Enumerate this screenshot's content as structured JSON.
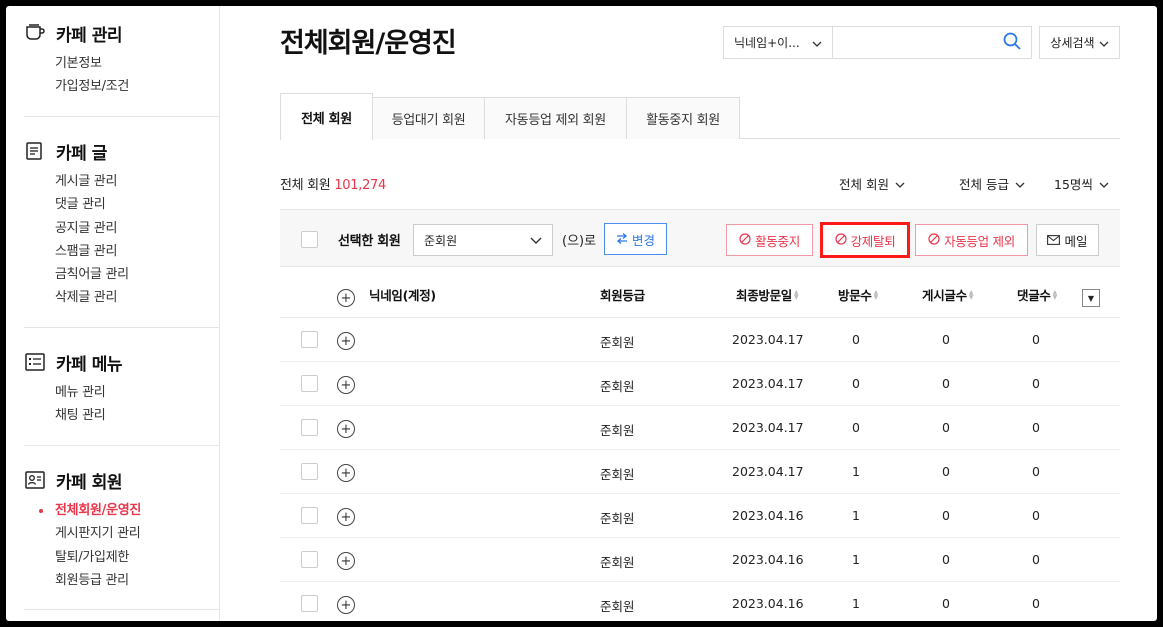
{
  "sidebar": {
    "sections": [
      {
        "title": "카페 관리",
        "icon": "cafe-cup-icon",
        "items": [
          "기본정보",
          "가입정보/조건"
        ]
      },
      {
        "title": "카페 글",
        "icon": "document-icon",
        "items": [
          "게시글 관리",
          "댓글 관리",
          "공지글 관리",
          "스팸글 관리",
          "금칙어글 관리",
          "삭제글 관리"
        ]
      },
      {
        "title": "카페 메뉴",
        "icon": "menu-list-icon",
        "items": [
          "메뉴 관리",
          "채팅 관리"
        ]
      },
      {
        "title": "카페 회원",
        "icon": "member-card-icon",
        "items": [
          "전체회원/운영진",
          "게시판지기 관리",
          "탈퇴/가입제한",
          "회원등급 관리"
        ]
      }
    ],
    "active_item": "전체회원/운영진"
  },
  "header": {
    "title": "전체회원/운영진",
    "search_type": "닉네임+이...",
    "search_value": "",
    "detail_search": "상세검색"
  },
  "tabs": [
    "전체 회원",
    "등업대기 회원",
    "자동등업 제외 회원",
    "활동중지 회원"
  ],
  "summary": {
    "label": "전체 회원",
    "count": "101,274",
    "filter_member": "전체 회원",
    "filter_grade": "전체 등급",
    "filter_page": "15명씩"
  },
  "actionbar": {
    "selected_label": "선택한 회원",
    "grade_value": "준회원",
    "suffix": "(으)로",
    "change": "변경",
    "suspend": "활동중지",
    "force_withdraw": "강제탈퇴",
    "exclude_autoup": "자동등업 제외",
    "mail": "메일"
  },
  "table": {
    "headers": {
      "nickname": "닉네임(계정)",
      "grade": "회원등급",
      "last_visit": "최종방문일",
      "visits": "방문수",
      "posts": "게시글수",
      "comments": "댓글수"
    },
    "rows": [
      {
        "grade": "준회원",
        "last_visit": "2023.04.17",
        "visits": "0",
        "posts": "0",
        "comments": "0"
      },
      {
        "grade": "준회원",
        "last_visit": "2023.04.17",
        "visits": "0",
        "posts": "0",
        "comments": "0"
      },
      {
        "grade": "준회원",
        "last_visit": "2023.04.17",
        "visits": "0",
        "posts": "0",
        "comments": "0"
      },
      {
        "grade": "준회원",
        "last_visit": "2023.04.17",
        "visits": "1",
        "posts": "0",
        "comments": "0"
      },
      {
        "grade": "준회원",
        "last_visit": "2023.04.16",
        "visits": "1",
        "posts": "0",
        "comments": "0"
      },
      {
        "grade": "준회원",
        "last_visit": "2023.04.16",
        "visits": "1",
        "posts": "0",
        "comments": "0"
      },
      {
        "grade": "준회원",
        "last_visit": "2023.04.16",
        "visits": "1",
        "posts": "0",
        "comments": "0"
      }
    ]
  },
  "colors": {
    "accent_red": "#e8364a",
    "highlight": "#ff1a1a",
    "accent_blue": "#2e78e6"
  }
}
